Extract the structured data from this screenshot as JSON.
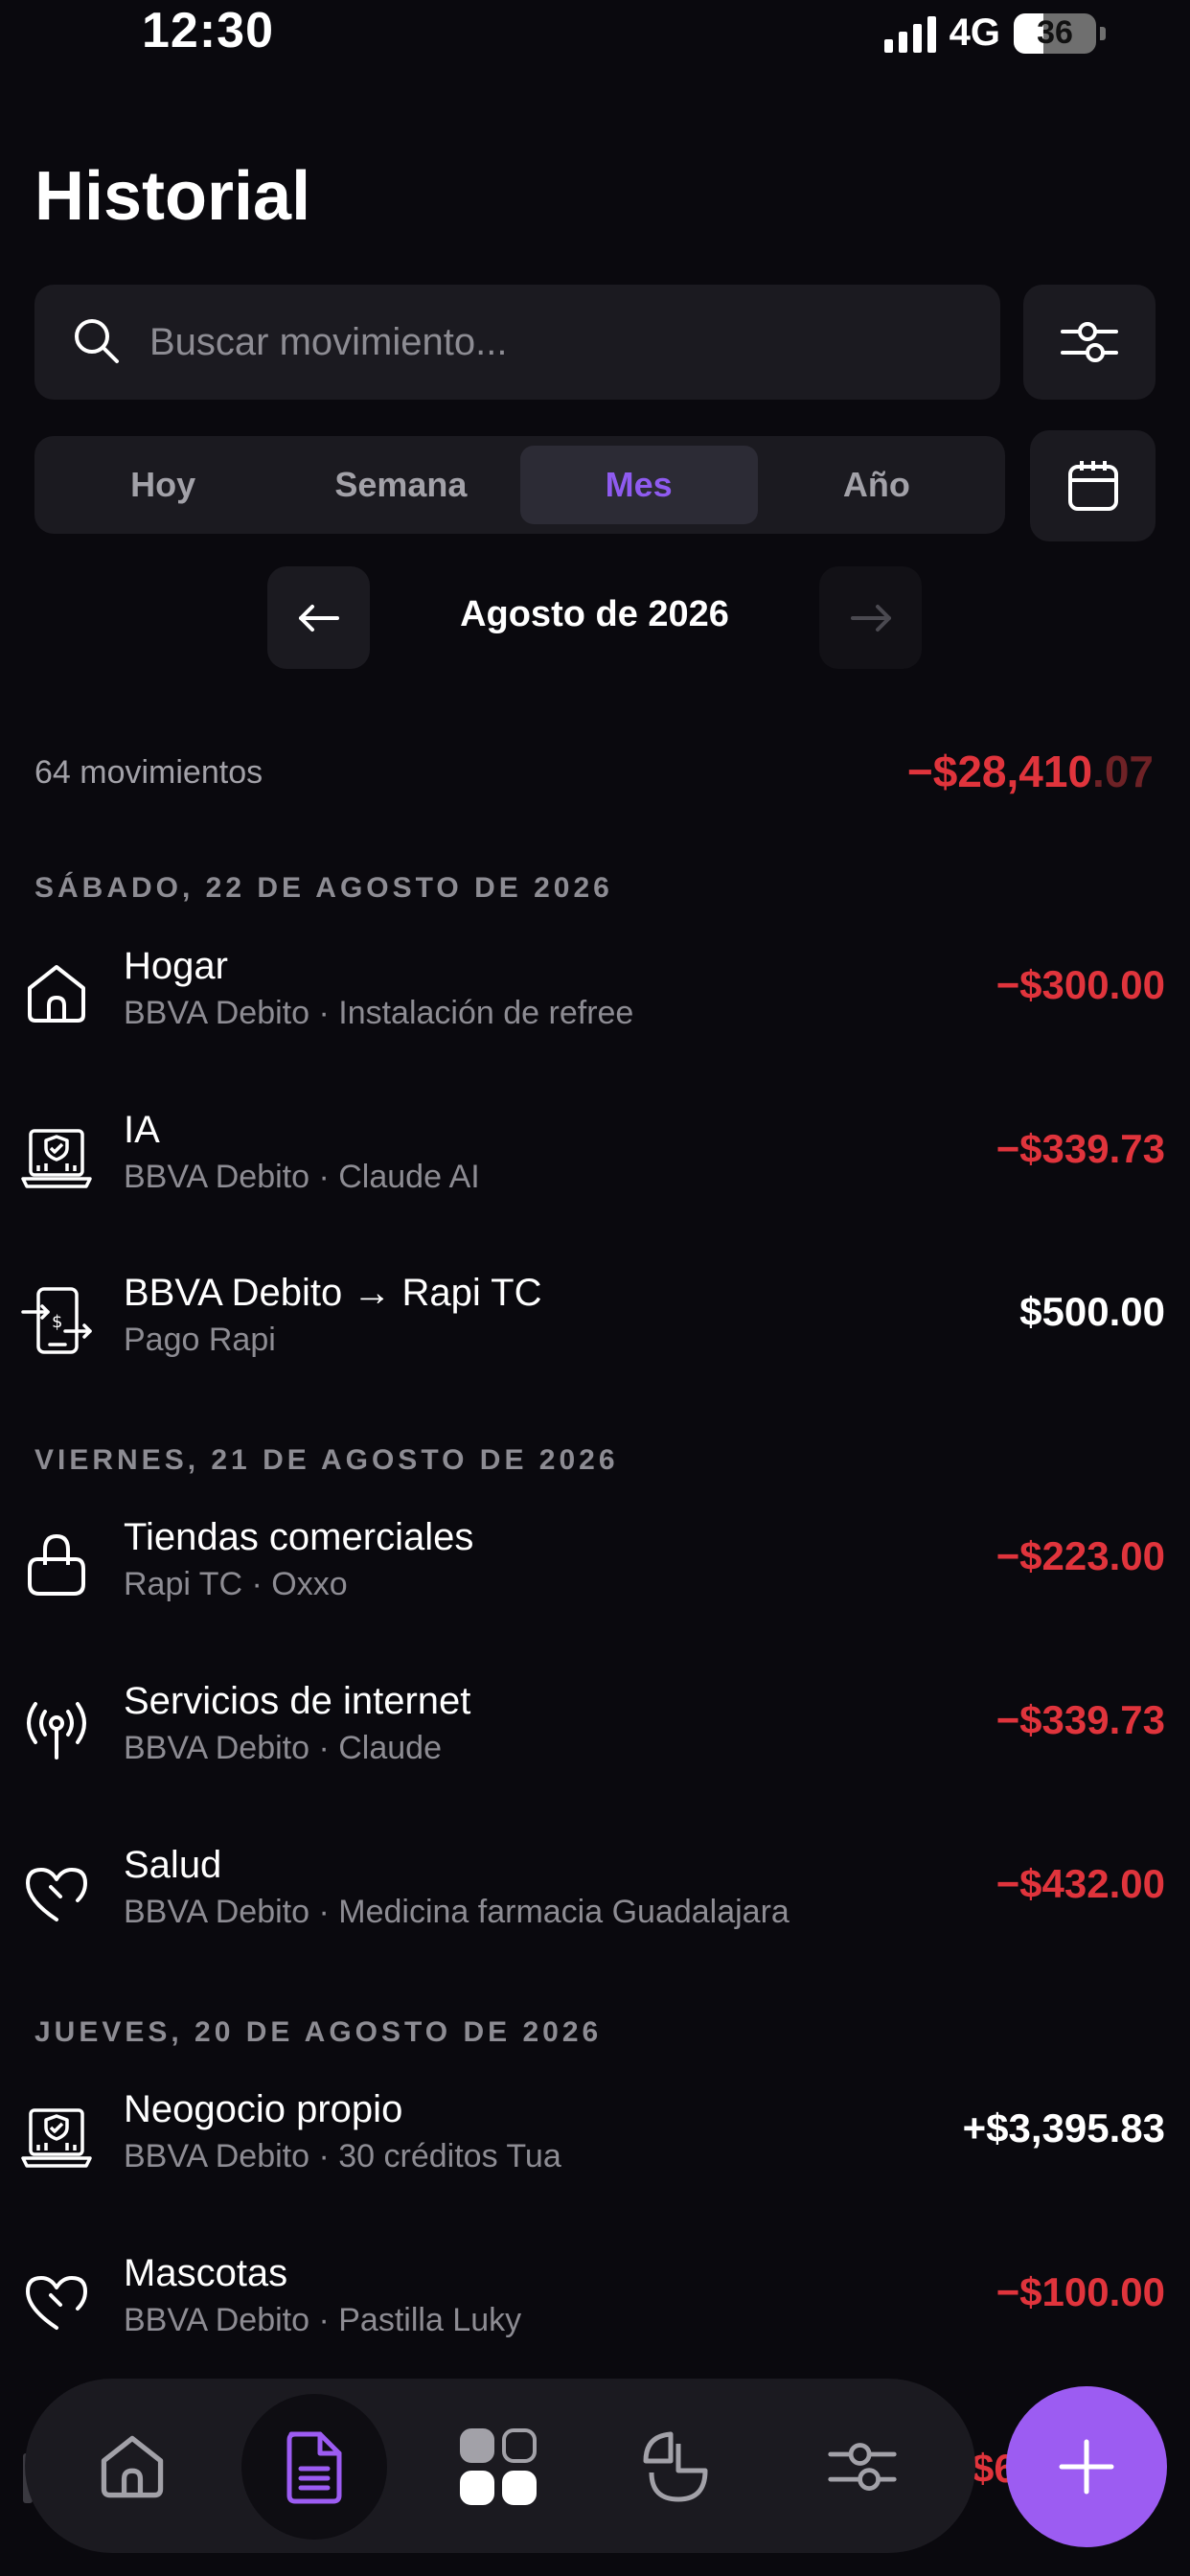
{
  "status": {
    "time": "12:30",
    "network": "4G",
    "battery": "36"
  },
  "header": {
    "title": "Historial"
  },
  "search": {
    "placeholder": "Buscar movimiento..."
  },
  "period_tabs": [
    {
      "label": "Hoy",
      "active": false
    },
    {
      "label": "Semana",
      "active": false
    },
    {
      "label": "Mes",
      "active": true
    },
    {
      "label": "Año",
      "active": false
    }
  ],
  "month_nav": {
    "label": "Agosto de 2026"
  },
  "summary": {
    "count_label": "64 movimientos",
    "total_main": "−$28,410",
    "total_cents": ".07"
  },
  "days": [
    {
      "header": "SÁBADO, 22 DE AGOSTO DE 2026",
      "transactions": [
        {
          "title": "Hogar",
          "subtitle": "BBVA Debito · Instalación de refree",
          "amount": "−$300.00",
          "kind": "neg",
          "icon": "home-icon"
        },
        {
          "title": "IA",
          "subtitle": "BBVA Debito · Claude AI",
          "amount": "−$339.73",
          "kind": "neg",
          "icon": "laptop-shield-icon"
        },
        {
          "title": "BBVA Debito → Rapi TC",
          "subtitle": "Pago Rapi",
          "amount": "$500.00",
          "kind": "pos",
          "icon": "transfer-icon"
        }
      ]
    },
    {
      "header": "VIERNES, 21 DE AGOSTO DE 2026",
      "transactions": [
        {
          "title": "Tiendas comerciales",
          "subtitle": "Rapi TC · Oxxo",
          "amount": "−$223.00",
          "kind": "neg",
          "icon": "shopping-bag-icon"
        },
        {
          "title": "Servicios de internet",
          "subtitle": "BBVA Debito · Claude",
          "amount": "−$339.73",
          "kind": "neg",
          "icon": "broadcast-icon"
        },
        {
          "title": "Salud",
          "subtitle": "BBVA Debito · Medicina farmacia Guadalajara",
          "amount": "−$432.00",
          "kind": "neg",
          "icon": "heart-icon"
        }
      ]
    },
    {
      "header": "JUEVES, 20 DE AGOSTO DE 2026",
      "transactions": [
        {
          "title": "Neogocio propio",
          "subtitle": "BBVA Debito · 30 créditos Tua",
          "amount": "+$3,395.83",
          "kind": "pos",
          "icon": "laptop-shield-icon"
        },
        {
          "title": "Mascotas",
          "subtitle": "BBVA Debito · Pastilla Luky",
          "amount": "−$100.00",
          "kind": "neg",
          "icon": "heart-icon"
        }
      ]
    }
  ],
  "peek_amount": "$6",
  "bottom_nav": [
    {
      "name": "home",
      "icon": "home-icon",
      "active": false
    },
    {
      "name": "history",
      "icon": "document-icon",
      "active": true
    },
    {
      "name": "categories",
      "icon": "grid-icon",
      "active": false
    },
    {
      "name": "reports",
      "icon": "pie-chart-icon",
      "active": false
    },
    {
      "name": "settings",
      "icon": "sliders-icon",
      "active": false
    }
  ],
  "colors": {
    "accent": "#9c5cf2",
    "negative": "#e0343c",
    "background": "#0a090e",
    "surface": "#1b1a20"
  }
}
